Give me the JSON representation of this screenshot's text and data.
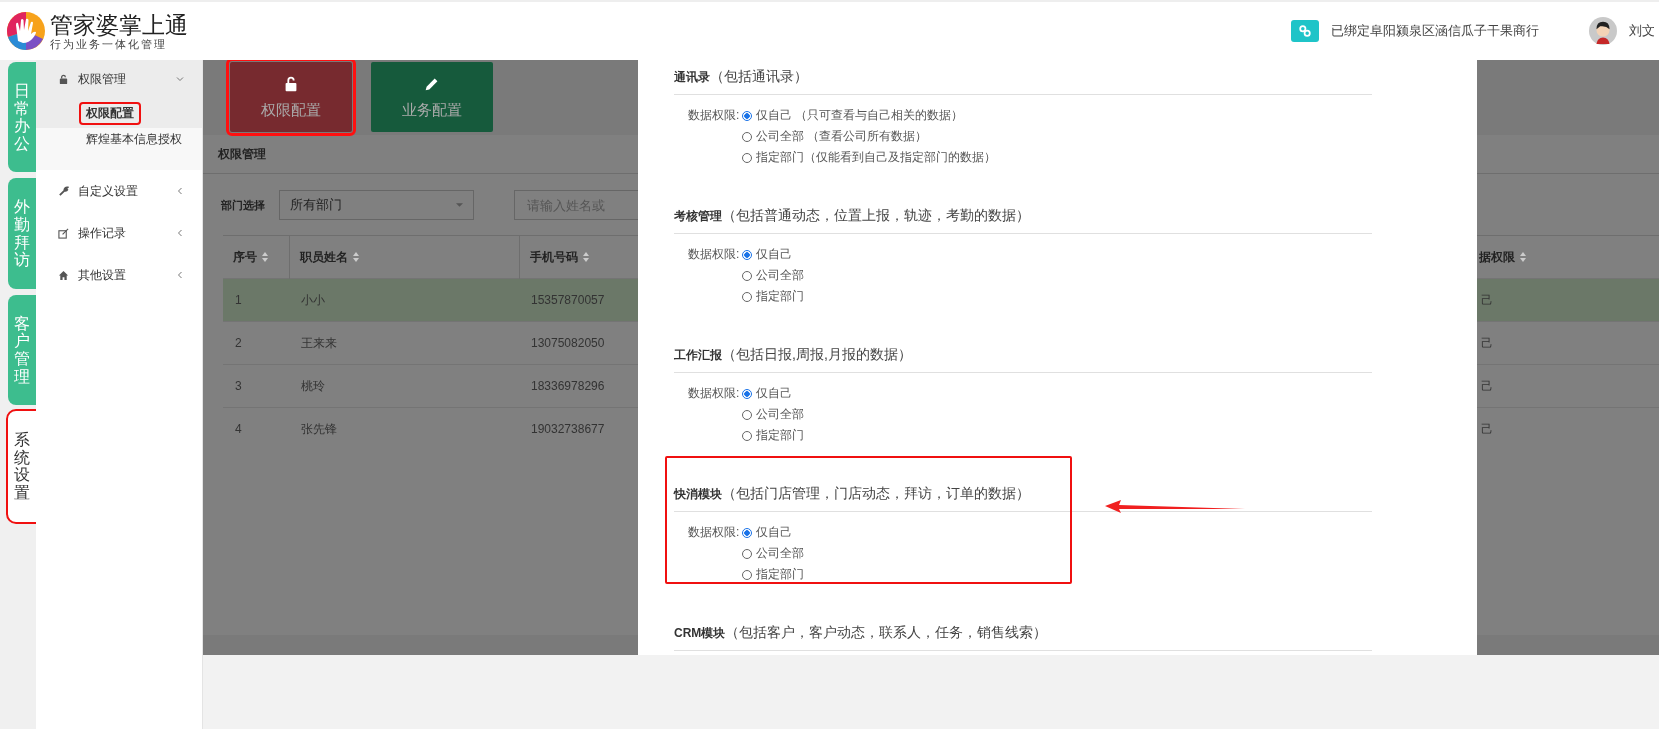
{
  "header": {
    "logo_title": "管家婆掌上通",
    "logo_subtitle": "行为业务一体化管理",
    "bound_store": "已绑定阜阳颍泉区涵信瓜子干果商行",
    "user_name": "刘文"
  },
  "rail_tabs": [
    {
      "label": "日常办公",
      "selected": false,
      "highlighted": false
    },
    {
      "label": "外勤拜访",
      "selected": false,
      "highlighted": false
    },
    {
      "label": "客户管理",
      "selected": false,
      "highlighted": false
    },
    {
      "label": "系统设置",
      "selected": true,
      "highlighted": true
    }
  ],
  "sidebar": {
    "items": [
      {
        "label": "权限管理",
        "kind": "lock",
        "expanded": true,
        "children": [
          {
            "label": "权限配置",
            "selected": true,
            "highlighted": true
          },
          {
            "label": "辉煌基本信息授权",
            "selected": false,
            "highlighted": false
          }
        ]
      },
      {
        "label": "自定义设置",
        "kind": "wrench",
        "expanded": false
      },
      {
        "label": "操作记录",
        "kind": "edit",
        "expanded": false
      },
      {
        "label": "其他设置",
        "kind": "home",
        "expanded": false
      }
    ]
  },
  "action_buttons": [
    {
      "label": "权限配置",
      "kind": "lock",
      "color": "#772a2f",
      "highlighted": true
    },
    {
      "label": "业务配置",
      "kind": "pencil",
      "color": "#165a3c",
      "highlighted": false
    }
  ],
  "panel_title": "权限管理",
  "filter": {
    "label": "部门选择",
    "department": "所有部门",
    "search_placeholder": "请输入姓名或"
  },
  "table": {
    "columns": [
      "序号",
      "职员姓名",
      "手机号码",
      "据权限"
    ],
    "rows": [
      {
        "cells": [
          "1",
          "小小",
          "15357870057",
          "己"
        ],
        "selected": true
      },
      {
        "cells": [
          "2",
          "王来来",
          "13075082050",
          "己"
        ],
        "selected": false
      },
      {
        "cells": [
          "3",
          "桃玲",
          "18336978296",
          "己"
        ],
        "selected": false
      },
      {
        "cells": [
          "4",
          "张先锋",
          "19032738677",
          "己"
        ],
        "selected": false
      }
    ]
  },
  "modal": {
    "sections": [
      {
        "title": "通讯录",
        "note": "（包括通讯录）",
        "label": "数据权限:",
        "highlighted": false,
        "options": [
          {
            "text": "仅自己 （只可查看与自己相关的数据）",
            "selected": true
          },
          {
            "text": "公司全部 （查看公司所有数据）",
            "selected": false
          },
          {
            "text": "指定部门（仅能看到自己及指定部门的数据）",
            "selected": false
          }
        ]
      },
      {
        "title": "考核管理",
        "note": "（包括普通动态，位置上报，轨迹，考勤的数据）",
        "label": "数据权限:",
        "highlighted": false,
        "options": [
          {
            "text": "仅自己",
            "selected": true
          },
          {
            "text": "公司全部",
            "selected": false
          },
          {
            "text": "指定部门",
            "selected": false
          }
        ]
      },
      {
        "title": "工作汇报",
        "note": "（包括日报,周报,月报的数据）",
        "label": "数据权限:",
        "highlighted": false,
        "options": [
          {
            "text": "仅自己",
            "selected": true
          },
          {
            "text": "公司全部",
            "selected": false
          },
          {
            "text": "指定部门",
            "selected": false
          }
        ]
      },
      {
        "title": "快消模块",
        "note": "（包括门店管理，门店动态，拜访，订单的数据）",
        "label": "数据权限:",
        "highlighted": true,
        "options": [
          {
            "text": "仅自己",
            "selected": true
          },
          {
            "text": "公司全部",
            "selected": false
          },
          {
            "text": "指定部门",
            "selected": false
          }
        ]
      },
      {
        "title": "CRM模块",
        "note": "（包括客户，客户动态，联系人，任务，销售线索）",
        "highlighted": false
      }
    ]
  }
}
